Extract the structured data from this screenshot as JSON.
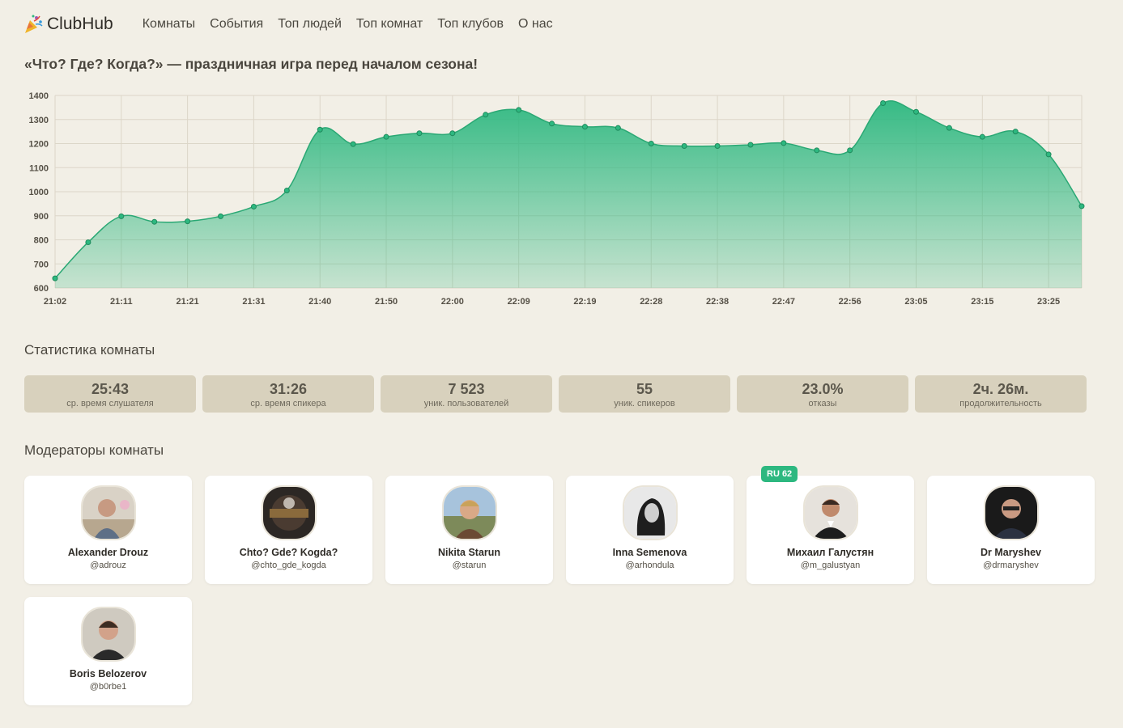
{
  "app": {
    "name": "ClubHub",
    "logo_icon": "party-popper-icon"
  },
  "nav": [
    {
      "label": "Комнаты"
    },
    {
      "label": "События"
    },
    {
      "label": "Топ людей"
    },
    {
      "label": "Топ комнат"
    },
    {
      "label": "Топ клубов"
    },
    {
      "label": "О нас"
    }
  ],
  "room": {
    "title": "«Что? Где? Когда?» — праздничная игра перед началом сезона!"
  },
  "colors": {
    "accent": "#2db880",
    "background": "#f2efe6",
    "stat_bg": "#d8d1bd"
  },
  "chart_data": {
    "type": "area",
    "ylim": [
      600,
      1400
    ],
    "y_ticks": [
      600,
      700,
      800,
      900,
      1000,
      1100,
      1200,
      1300,
      1400
    ],
    "x_tick_labels": [
      "21:02",
      "21:11",
      "21:21",
      "21:31",
      "21:40",
      "21:50",
      "22:00",
      "22:09",
      "22:19",
      "22:28",
      "22:38",
      "22:47",
      "22:56",
      "23:05",
      "23:15",
      "23:25"
    ],
    "grid": true,
    "series": [
      {
        "values": [
          640,
          790,
          898,
          875,
          877,
          898,
          938,
          1005,
          1258,
          1198,
          1228,
          1243,
          1243,
          1320,
          1340,
          1283,
          1270,
          1265,
          1200,
          1190,
          1190,
          1195,
          1202,
          1172,
          1172,
          1368,
          1332,
          1265,
          1228,
          1250,
          1155,
          940
        ]
      }
    ]
  },
  "stats": {
    "title": "Статистика комнаты",
    "items": [
      {
        "value": "25:43",
        "label": "ср. время слушателя"
      },
      {
        "value": "31:26",
        "label": "ср. время спикера"
      },
      {
        "value": "7 523",
        "label": "уник. пользователей"
      },
      {
        "value": "55",
        "label": "уник. спикеров"
      },
      {
        "value": "23.0%",
        "label": "отказы"
      },
      {
        "value": "2ч. 26м.",
        "label": "продолжительность"
      }
    ]
  },
  "moderators": {
    "title": "Модераторы комнаты",
    "items": [
      {
        "name": "Alexander Drouz",
        "handle": "@adrouz"
      },
      {
        "name": "Chto? Gde? Kogda?",
        "handle": "@chto_gde_kogda"
      },
      {
        "name": "Nikita Starun",
        "handle": "@starun"
      },
      {
        "name": "Inna Semenova",
        "handle": "@arhondula"
      },
      {
        "name": "Михаил Галустян",
        "handle": "@m_galustyan",
        "badge": "RU 62"
      },
      {
        "name": "Dr Maryshev",
        "handle": "@drmaryshev"
      },
      {
        "name": "Boris Belozerov",
        "handle": "@b0rbe1"
      }
    ]
  }
}
